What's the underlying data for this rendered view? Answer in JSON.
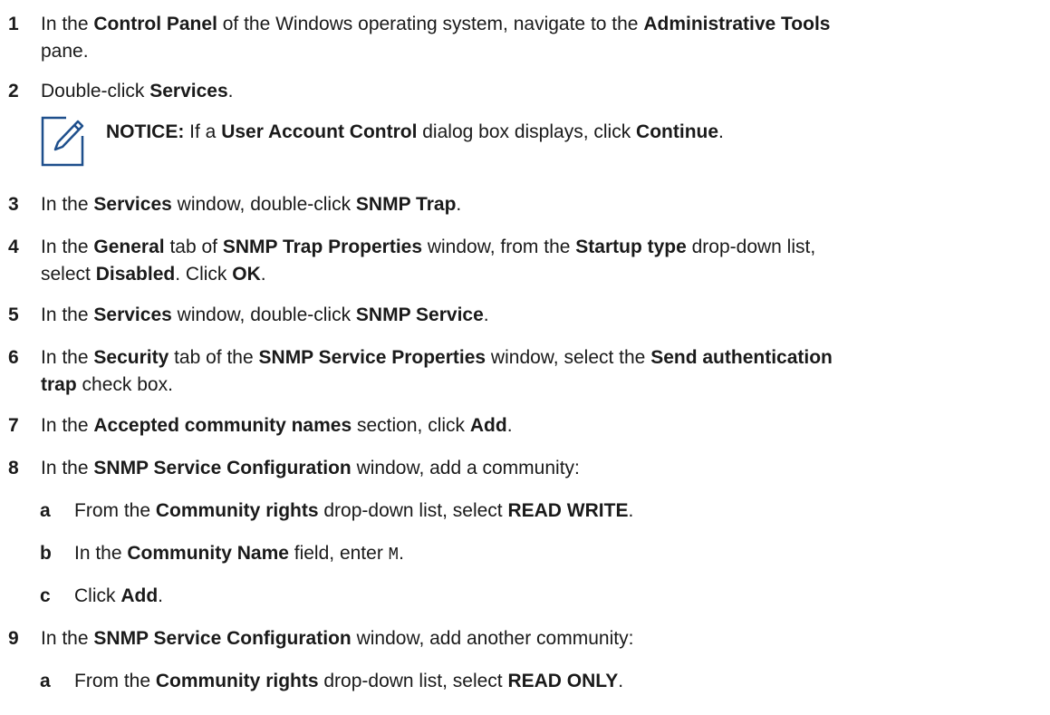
{
  "steps": [
    {
      "num": "1",
      "parts": [
        {
          "t": "In the "
        },
        {
          "t": "Control Panel",
          "b": true
        },
        {
          "t": " of the Windows operating system, navigate to the "
        },
        {
          "t": "Administrative Tools",
          "b": true
        },
        {
          "br": true
        },
        {
          "t": "pane."
        }
      ]
    },
    {
      "num": "2",
      "parts": [
        {
          "t": "Double-click "
        },
        {
          "t": "Services",
          "b": true
        },
        {
          "t": "."
        }
      ]
    },
    {
      "num": "3",
      "parts": [
        {
          "t": "In the "
        },
        {
          "t": "Services",
          "b": true
        },
        {
          "t": " window, double-click "
        },
        {
          "t": "SNMP Trap",
          "b": true
        },
        {
          "t": "."
        }
      ]
    },
    {
      "num": "4",
      "parts": [
        {
          "t": "In the "
        },
        {
          "t": "General",
          "b": true
        },
        {
          "t": " tab of "
        },
        {
          "t": "SNMP Trap Properties",
          "b": true
        },
        {
          "t": " window, from the "
        },
        {
          "t": "Startup type",
          "b": true
        },
        {
          "t": " drop-down list,"
        },
        {
          "br": true
        },
        {
          "t": "select "
        },
        {
          "t": "Disabled",
          "b": true
        },
        {
          "t": ". Click "
        },
        {
          "t": "OK",
          "b": true
        },
        {
          "t": "."
        }
      ]
    },
    {
      "num": "5",
      "parts": [
        {
          "t": "In the "
        },
        {
          "t": "Services",
          "b": true
        },
        {
          "t": " window, double-click "
        },
        {
          "t": "SNMP Service",
          "b": true
        },
        {
          "t": "."
        }
      ]
    },
    {
      "num": "6",
      "parts": [
        {
          "t": "In the "
        },
        {
          "t": "Security",
          "b": true
        },
        {
          "t": " tab of the "
        },
        {
          "t": "SNMP Service Properties",
          "b": true
        },
        {
          "t": " window, select the "
        },
        {
          "t": "Send authentication",
          "b": true
        },
        {
          "br": true
        },
        {
          "t": "trap",
          "b": true
        },
        {
          "t": " check box."
        }
      ]
    },
    {
      "num": "7",
      "parts": [
        {
          "t": "In the "
        },
        {
          "t": "Accepted community names",
          "b": true
        },
        {
          "t": " section, click "
        },
        {
          "t": "Add",
          "b": true
        },
        {
          "t": "."
        }
      ]
    },
    {
      "num": "8",
      "parts": [
        {
          "t": "In the "
        },
        {
          "t": "SNMP Service Configuration",
          "b": true
        },
        {
          "t": " window, add a community:"
        }
      ]
    },
    {
      "num": "a",
      "parts": [
        {
          "t": "From the "
        },
        {
          "t": "Community rights",
          "b": true
        },
        {
          "t": " drop-down list, select "
        },
        {
          "t": "READ WRITE",
          "b": true
        },
        {
          "t": "."
        }
      ]
    },
    {
      "num": "b",
      "parts": [
        {
          "t": "In the "
        },
        {
          "t": "Community Name",
          "b": true
        },
        {
          "t": " field, enter "
        },
        {
          "t": "M",
          "m": true
        },
        {
          "t": "."
        }
      ]
    },
    {
      "num": "c",
      "parts": [
        {
          "t": "Click "
        },
        {
          "t": "Add",
          "b": true
        },
        {
          "t": "."
        }
      ]
    },
    {
      "num": "9",
      "parts": [
        {
          "t": "In the "
        },
        {
          "t": "SNMP Service Configuration",
          "b": true
        },
        {
          "t": " window, add another community:"
        }
      ]
    },
    {
      "num": "a",
      "parts": [
        {
          "t": "From the "
        },
        {
          "t": "Community rights",
          "b": true
        },
        {
          "t": " drop-down list, select "
        },
        {
          "t": "READ ONLY",
          "b": true
        },
        {
          "t": "."
        }
      ]
    }
  ],
  "notice": {
    "label": "NOTICE:",
    "parts": [
      {
        "t": " If a "
      },
      {
        "t": "User Account Control",
        "b": true
      },
      {
        "t": " dialog box displays, click "
      },
      {
        "t": "Continue",
        "b": true
      },
      {
        "t": "."
      }
    ],
    "icon": "notice-pencil-icon",
    "icon_color": "#1e4f8c"
  }
}
